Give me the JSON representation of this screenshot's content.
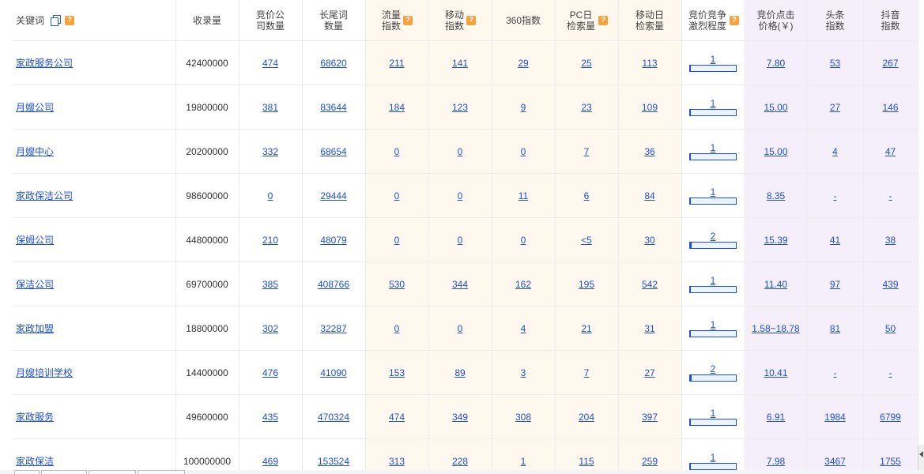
{
  "header": {
    "keyword": "关键词",
    "index_count": "收录量",
    "bid_companies": "竞价公司数量",
    "long_tail": "长尾词数量",
    "traffic_index": "流量指数",
    "mobile_index": "移动指数",
    "index_360": "360指数",
    "pc_daily": "PC日检索量",
    "mobile_daily": "移动日检索量",
    "competition": "竞价竞争激烈程度",
    "click_price": "竞价点击价格(￥)",
    "toutiao": "头条指数",
    "douyin": "抖音指数"
  },
  "icons": {
    "copy": "copy-icon",
    "help": "help-icon",
    "help_glyph": "?"
  },
  "colors": {
    "link": "#1f4fd8",
    "help_badge": "#f7a23b",
    "traffic_bg": "#fff8ef",
    "price_bg": "#f5effb"
  },
  "rows": [
    {
      "keyword": "家政服务公司",
      "index_count": "42400000",
      "bid_companies": "474",
      "long_tail": "68620",
      "traffic_index": "211",
      "mobile_index": "141",
      "index_360": "29",
      "pc_daily": "25",
      "mobile_daily": "113",
      "competition": "1",
      "competition_level": 0.02,
      "click_price": "7.80",
      "toutiao": "53",
      "douyin": "267"
    },
    {
      "keyword": "月嫂公司",
      "index_count": "19800000",
      "bid_companies": "381",
      "long_tail": "83644",
      "traffic_index": "184",
      "mobile_index": "123",
      "index_360": "9",
      "pc_daily": "23",
      "mobile_daily": "109",
      "competition": "1",
      "competition_level": 0.02,
      "click_price": "15.00",
      "toutiao": "27",
      "douyin": "146"
    },
    {
      "keyword": "月嫂中心",
      "index_count": "20200000",
      "bid_companies": "332",
      "long_tail": "68654",
      "traffic_index": "0",
      "mobile_index": "0",
      "index_360": "0",
      "pc_daily": "7",
      "mobile_daily": "36",
      "competition": "1",
      "competition_level": 0.02,
      "click_price": "15.00",
      "toutiao": "4",
      "douyin": "47"
    },
    {
      "keyword": "家政保洁公司",
      "index_count": "98600000",
      "bid_companies": "0",
      "long_tail": "29444",
      "traffic_index": "0",
      "mobile_index": "0",
      "index_360": "11",
      "pc_daily": "6",
      "mobile_daily": "84",
      "competition": "1",
      "competition_level": 0.02,
      "click_price": "8.35",
      "toutiao": "-",
      "douyin": "-"
    },
    {
      "keyword": "保姆公司",
      "index_count": "44800000",
      "bid_companies": "210",
      "long_tail": "48079",
      "traffic_index": "0",
      "mobile_index": "0",
      "index_360": "0",
      "pc_daily": "<5",
      "mobile_daily": "30",
      "competition": "2",
      "competition_level": 0.04,
      "click_price": "15.39",
      "toutiao": "41",
      "douyin": "38"
    },
    {
      "keyword": "保洁公司",
      "index_count": "69700000",
      "bid_companies": "385",
      "long_tail": "408766",
      "traffic_index": "530",
      "mobile_index": "344",
      "index_360": "162",
      "pc_daily": "195",
      "mobile_daily": "542",
      "competition": "1",
      "competition_level": 0.02,
      "click_price": "11.40",
      "toutiao": "97",
      "douyin": "439"
    },
    {
      "keyword": "家政加盟",
      "index_count": "18800000",
      "bid_companies": "302",
      "long_tail": "32287",
      "traffic_index": "0",
      "mobile_index": "0",
      "index_360": "4",
      "pc_daily": "21",
      "mobile_daily": "31",
      "competition": "1",
      "competition_level": 0.02,
      "click_price": "1.58~18.78",
      "toutiao": "81",
      "douyin": "50"
    },
    {
      "keyword": "月嫂培训学校",
      "index_count": "14400000",
      "bid_companies": "476",
      "long_tail": "41090",
      "traffic_index": "153",
      "mobile_index": "89",
      "index_360": "3",
      "pc_daily": "7",
      "mobile_daily": "27",
      "competition": "2",
      "competition_level": 0.04,
      "click_price": "10.41",
      "toutiao": "-",
      "douyin": "-"
    },
    {
      "keyword": "家政服务",
      "index_count": "49600000",
      "bid_companies": "435",
      "long_tail": "470324",
      "traffic_index": "474",
      "mobile_index": "349",
      "index_360": "308",
      "pc_daily": "204",
      "mobile_daily": "397",
      "competition": "1",
      "competition_level": 0.02,
      "click_price": "6.91",
      "toutiao": "1984",
      "douyin": "6799"
    },
    {
      "keyword": "家政保洁",
      "index_count": "100000000",
      "bid_companies": "469",
      "long_tail": "153524",
      "traffic_index": "313",
      "mobile_index": "228",
      "index_360": "1",
      "pc_daily": "115",
      "mobile_daily": "259",
      "competition": "1",
      "competition_level": 0.02,
      "click_price": "7.98",
      "toutiao": "3467",
      "douyin": "1755"
    }
  ]
}
